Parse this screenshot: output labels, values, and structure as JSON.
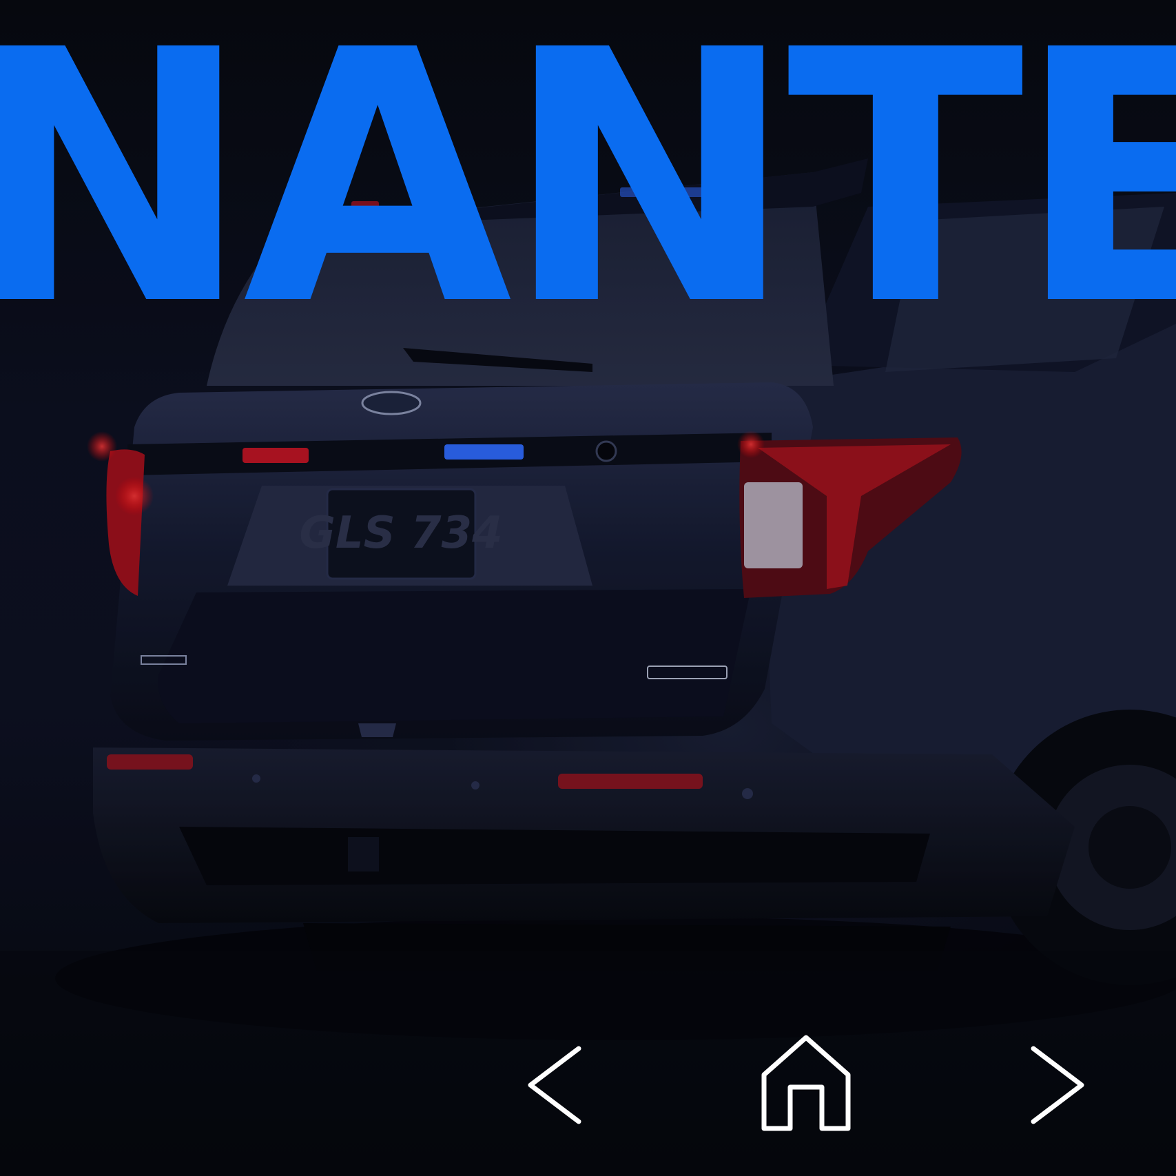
{
  "headline": {
    "text": "NANTE",
    "color": "#0a6cf0"
  },
  "vehicle": {
    "license_plate": "GLS 734"
  },
  "navigation": {
    "prev_icon": "chevron-left-icon",
    "home_icon": "home-icon",
    "next_icon": "chevron-right-icon",
    "icon_color": "#ffffff"
  },
  "colors": {
    "background": "#05070c",
    "body_paint": "#141a2e",
    "taillight_red": "#c0141e",
    "lightbar_blue": "#2e6bff"
  }
}
